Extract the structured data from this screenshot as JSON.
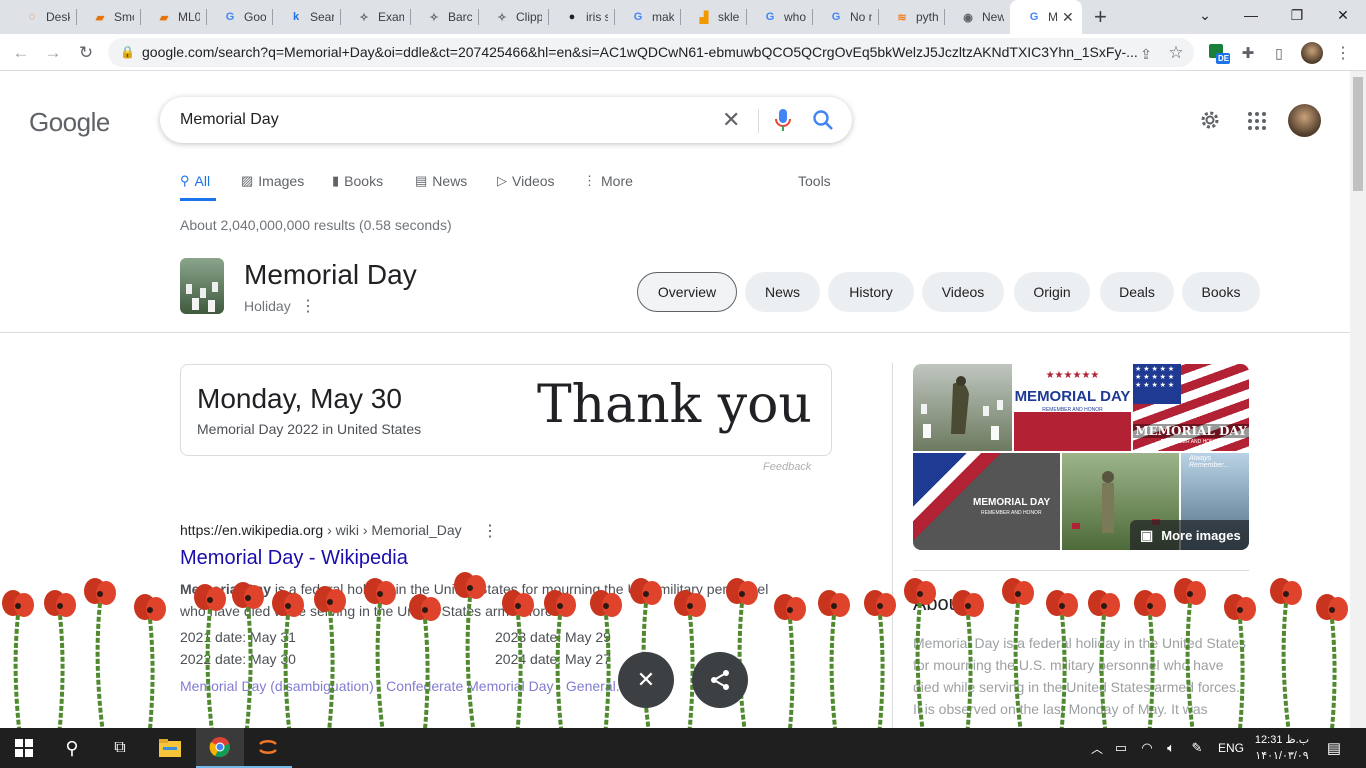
{
  "browser": {
    "tabs": [
      {
        "title": "Deskt",
        "icon": "orange-ring-icon",
        "icon_glyph": "◌",
        "icon_color": "#e8710a"
      },
      {
        "title": "Smok",
        "icon": "orange-notebook-icon",
        "icon_glyph": "▰",
        "icon_color": "#e8710a"
      },
      {
        "title": "ML01",
        "icon": "orange-notebook-icon",
        "icon_glyph": "▰",
        "icon_color": "#e8710a"
      },
      {
        "title": "Goog",
        "icon": "google-translate-icon",
        "icon_glyph": "G",
        "icon_color": "#4285f4"
      },
      {
        "title": "Searc",
        "icon": "k-icon",
        "icon_glyph": "k",
        "icon_color": "#1a73e8"
      },
      {
        "title": "Exam",
        "icon": "compass-icon",
        "icon_glyph": "✧",
        "icon_color": "#5f6368"
      },
      {
        "title": "Barco",
        "icon": "compass-icon",
        "icon_glyph": "✧",
        "icon_color": "#5f6368"
      },
      {
        "title": "Clipp",
        "icon": "compass-icon",
        "icon_glyph": "✧",
        "icon_color": "#5f6368"
      },
      {
        "title": "iris sv",
        "icon": "github-icon",
        "icon_glyph": "●",
        "icon_color": "#202124"
      },
      {
        "title": "make",
        "icon": "google-icon",
        "icon_glyph": "G",
        "icon_color": "#4285f4"
      },
      {
        "title": "sklea",
        "icon": "chart-icon",
        "icon_glyph": "▟",
        "icon_color": "#f29900"
      },
      {
        "title": "who i",
        "icon": "google-icon",
        "icon_glyph": "G",
        "icon_color": "#4285f4"
      },
      {
        "title": "No m",
        "icon": "google-icon",
        "icon_glyph": "G",
        "icon_color": "#4285f4"
      },
      {
        "title": "pytho",
        "icon": "stackoverflow-icon",
        "icon_glyph": "≋",
        "icon_color": "#f48024"
      },
      {
        "title": "New",
        "icon": "chrome-icon",
        "icon_glyph": "◉",
        "icon_color": "#5f6368"
      },
      {
        "title": "M",
        "icon": "google-icon",
        "icon_glyph": "G",
        "icon_color": "#4285f4",
        "active": true
      }
    ],
    "url": "google.com/search?q=Memorial+Day&oi=ddle&ct=207425466&hl=en&si=AC1wQDCwN61-ebmuwbQCO5QCrgOvEq5bkWelzJ5JczltzAKNdTXIC3Yhn_1SxFy-...",
    "ext_badge": "DE"
  },
  "google": {
    "logo": "Google",
    "query": "Memorial Day",
    "tabs": [
      {
        "label": "All",
        "icon": "search-icon",
        "active": true
      },
      {
        "label": "Images",
        "icon": "image-icon"
      },
      {
        "label": "Books",
        "icon": "book-icon"
      },
      {
        "label": "News",
        "icon": "news-icon"
      },
      {
        "label": "Videos",
        "icon": "video-icon"
      },
      {
        "label": "More",
        "icon": "more-vert-icon"
      }
    ],
    "tools": "Tools",
    "results_count": "About 2,040,000,000 results (0.58 seconds)"
  },
  "entity": {
    "title": "Memorial Day",
    "subtitle": "Holiday",
    "chips": [
      "Overview",
      "News",
      "History",
      "Videos",
      "Origin",
      "Deals",
      "Books"
    ]
  },
  "date_card": {
    "date": "Monday, May 30",
    "sub": "Memorial Day 2022 in United States",
    "doodle_text": "Thank you",
    "feedback": "Feedback"
  },
  "result": {
    "breadcrumb_site": "https://en.wikipedia.org",
    "breadcrumb_path": " › wiki › Memorial_Day",
    "title": "Memorial Day - Wikipedia",
    "snippet_bold": "Memorial Day",
    "snippet_rest": " is a federal holiday in the United States for mourning the U.S. military personnel",
    "snippet_line2": "who have died while serving in the United States armed forces.",
    "facts": [
      "2021 date: May 31",
      "2023 date: May 29",
      "2022 date: May 30",
      "2024 date: May 27"
    ],
    "links": "Memorial Day (disambiguation) · Confederate Memorial Day · General..."
  },
  "panel": {
    "more_images": "More images",
    "image_text_1": "MEMORIAL DAY",
    "image_text_1_sub": "REMEMBER AND HONOR",
    "image_text_2": "MEMORIAL DAY",
    "image_text_2_sub": "REMEMBER AND HONOR",
    "image_text_3": "MEMORIAL DAY",
    "image_text_3_sub": "REMEMBER AND HONOR",
    "image_text_4": "Always Remember...",
    "about_title": "About",
    "about_text_1": "Memorial Day is a federal holiday in the United States",
    "about_text_2": "for mourning the U.S. military personnel who have",
    "about_text_3": "died while serving in the United States armed forces.",
    "about_text_4": "It is observed on the last Monday of May. It was"
  },
  "taskbar": {
    "lang": "ENG",
    "time": "12:31 ب.ظ",
    "date": "۱۴۰۱/۰۳/۰۹"
  }
}
